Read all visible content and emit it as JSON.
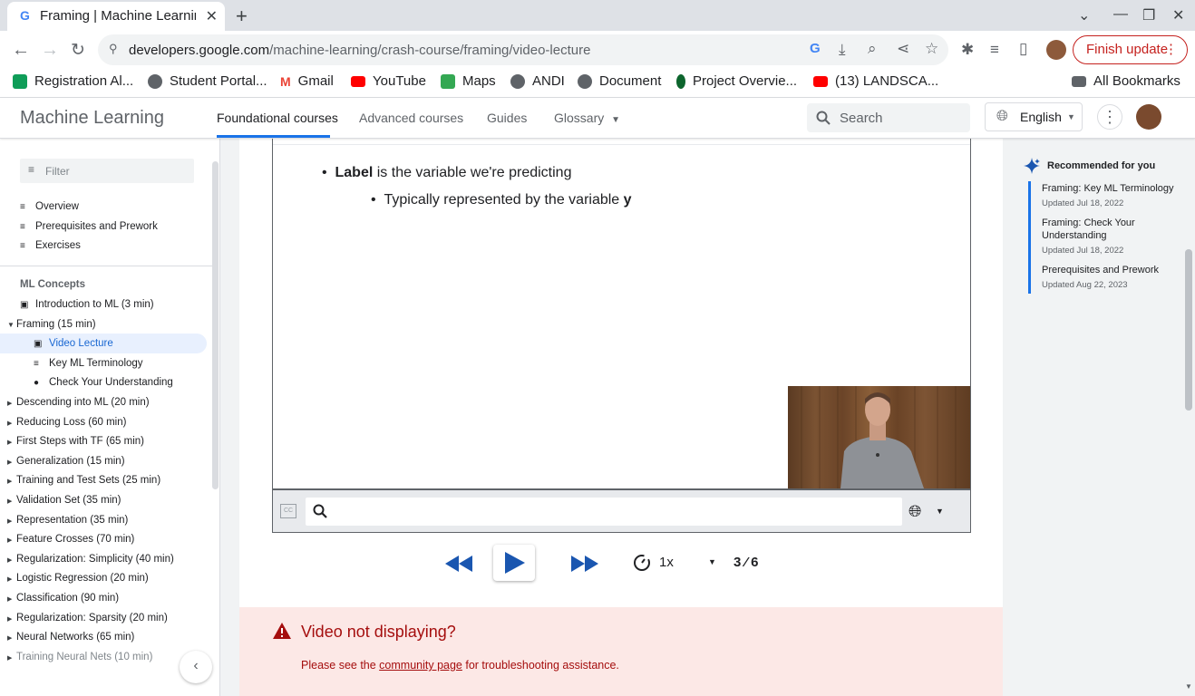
{
  "browser": {
    "tab_title": "Framing  |  Machine Learning",
    "url_domain": "developers.google.com",
    "url_path": "/machine-learning/crash-course/framing/video-lecture",
    "finish_update": "Finish update",
    "bookmarks": [
      {
        "label": "Registration Al...",
        "color": "#0f9d58"
      },
      {
        "label": "Student Portal...",
        "color": "#5f6368"
      },
      {
        "label": "Gmail",
        "color": "#ea4335"
      },
      {
        "label": "YouTube",
        "color": "#ff0000"
      },
      {
        "label": "Maps",
        "color": "#34a853"
      },
      {
        "label": "ANDI",
        "color": "#5f6368"
      },
      {
        "label": "Document",
        "color": "#5f6368"
      },
      {
        "label": "Project Overvie...",
        "color": "#0d652d"
      },
      {
        "label": "(13) LANDSCA...",
        "color": "#ff0000"
      }
    ],
    "all_bookmarks": "All Bookmarks"
  },
  "site": {
    "brand": "Machine Learning",
    "nav": [
      "Foundational courses",
      "Advanced courses",
      "Guides",
      "Glossary"
    ],
    "search_placeholder": "Search",
    "language": "English"
  },
  "sidebar": {
    "filter_placeholder": "Filter",
    "top_items": [
      "Overview",
      "Prerequisites and Prework",
      "Exercises"
    ],
    "section_title": "ML Concepts",
    "intro": "Introduction to ML (3 min)",
    "framing": "Framing (15 min)",
    "framing_children": [
      "Video Lecture",
      "Key ML Terminology",
      "Check Your Understanding"
    ],
    "modules": [
      "Descending into ML (20 min)",
      "Reducing Loss (60 min)",
      "First Steps with TF (65 min)",
      "Generalization (15 min)",
      "Training and Test Sets (25 min)",
      "Validation Set (35 min)",
      "Representation (35 min)",
      "Feature Crosses (70 min)",
      "Regularization: Simplicity (40 min)",
      "Logistic Regression (20 min)",
      "Classification (90 min)",
      "Regularization: Sparsity (20 min)",
      "Neural Networks (65 min)",
      "Training Neural Nets (10 min)"
    ]
  },
  "slide": {
    "bullet1_bold": "Label",
    "bullet1_rest": " is the variable we're predicting",
    "bullet2_text": "Typically represented by the variable ",
    "bullet2_bold": "y"
  },
  "controls": {
    "speed": "1x",
    "page": "3 ⁄ 6"
  },
  "alert": {
    "title": "Video not displaying?",
    "body_pre": "Please see the ",
    "link": "community page",
    "body_post": " for troubleshooting assistance."
  },
  "recommended": {
    "title": "Recommended for you",
    "items": [
      {
        "title": "Framing: Key ML Terminology",
        "date": "Updated Jul 18, 2022"
      },
      {
        "title": "Framing: Check Your Understanding",
        "date": "Updated Jul 18, 2022"
      },
      {
        "title": "Prerequisites and Prework",
        "date": "Updated Aug 22, 2023"
      }
    ]
  }
}
